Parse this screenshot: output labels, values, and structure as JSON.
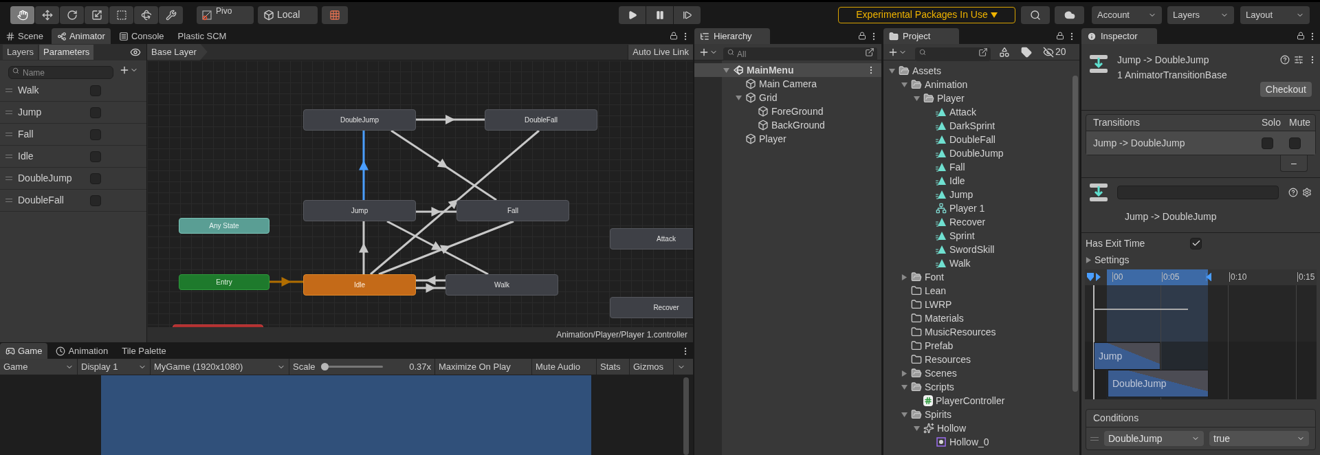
{
  "toolbar": {
    "tools": [
      {
        "kind": "hand",
        "selected": true
      },
      {
        "kind": "move",
        "selected": false
      },
      {
        "kind": "rotate",
        "selected": false
      },
      {
        "kind": "scale",
        "selected": false
      },
      {
        "kind": "rect",
        "selected": false
      },
      {
        "kind": "transform",
        "selected": false
      },
      {
        "kind": "custom",
        "selected": false
      }
    ],
    "pivot": "Pivo",
    "local": "Local",
    "experimental": "Experimental Packages In Use",
    "account": "Account",
    "layers": "Layers",
    "layout": "Layout"
  },
  "animator_panel": {
    "tabs": [
      {
        "label": "Scene",
        "kind": "scene",
        "selected": false
      },
      {
        "label": "Animator",
        "kind": "animator",
        "selected": true
      },
      {
        "label": "Console",
        "kind": "console",
        "selected": false
      },
      {
        "label": "Plastic SCM",
        "kind": "plain",
        "selected": false
      }
    ],
    "subtabs": [
      {
        "label": "Layers",
        "selected": false
      },
      {
        "label": "Parameters",
        "selected": true
      }
    ],
    "search_placeholder": "Name",
    "breadcrumb": "Base Layer",
    "live_link": "Auto Live Link",
    "parameters": [
      {
        "name": "Walk",
        "checked": false
      },
      {
        "name": "Jump",
        "checked": false
      },
      {
        "name": "Fall",
        "checked": false
      },
      {
        "name": "Idle",
        "checked": false
      },
      {
        "name": "DoubleJump",
        "checked": false
      },
      {
        "name": "DoubleFall",
        "checked": false
      }
    ],
    "states": [
      {
        "label": "DoubleJump",
        "kind": "state"
      },
      {
        "label": "DoubleFall",
        "kind": "state"
      },
      {
        "label": "Jump",
        "kind": "state"
      },
      {
        "label": "Fall",
        "kind": "state"
      },
      {
        "label": "Any State",
        "kind": "any"
      },
      {
        "label": "Entry",
        "kind": "entry"
      },
      {
        "label": "Idle",
        "kind": "default"
      },
      {
        "label": "Walk",
        "kind": "state"
      },
      {
        "label": "Attack",
        "kind": "state"
      },
      {
        "label": "Recover",
        "kind": "state"
      },
      {
        "kind": "exit"
      }
    ],
    "transitions": [
      {
        "kind": "normal",
        "selected": false
      },
      {
        "kind": "normal",
        "selected": false
      },
      {
        "kind": "normal",
        "selected": false
      },
      {
        "kind": "normal",
        "selected": false
      },
      {
        "kind": "normal",
        "selected": false
      },
      {
        "kind": "normal",
        "selected": false
      },
      {
        "kind": "normal",
        "selected": false
      },
      {
        "kind": "normal",
        "selected": false
      },
      {
        "kind": "normal",
        "selected": false
      },
      {
        "kind": "normal",
        "selected": true
      },
      {
        "kind": "entry",
        "selected": false
      }
    ],
    "path": "Animation/Player/Player 1.controller"
  },
  "game_panel": {
    "tabs": [
      {
        "label": "Game",
        "kind": "game",
        "selected": true
      },
      {
        "label": "Animation",
        "kind": "animation",
        "selected": false
      },
      {
        "label": "Tile Palette",
        "kind": "plain",
        "selected": false
      }
    ],
    "view_mode": "Game",
    "display": "Display 1",
    "resolution": "MyGame (1920x1080)",
    "scale_label": "Scale",
    "scale": {
      "level": 0.02
    },
    "scale_value": "0.37x",
    "maximize": "Maximize On Play",
    "mute": "Mute Audio",
    "stats": "Stats",
    "gizmos": "Gizmos"
  },
  "hierarchy": {
    "title": "Hierarchy",
    "search_placeholder": "All",
    "tree": [
      {
        "label": "MainMenu",
        "kind": "scene",
        "expanded": true,
        "children": [
          {
            "label": "Main Camera",
            "kind": "object"
          },
          {
            "label": "Grid",
            "kind": "object",
            "expanded": true,
            "children": [
              {
                "label": "ForeGround",
                "kind": "object"
              },
              {
                "label": "BackGround",
                "kind": "object"
              }
            ]
          },
          {
            "label": "Player",
            "kind": "object"
          }
        ]
      }
    ]
  },
  "project": {
    "title": "Project",
    "hidden_count": "20",
    "tree": [
      {
        "label": "Assets",
        "kind": "folder",
        "expanded": true,
        "children": [
          {
            "label": "Animation",
            "kind": "folder",
            "expanded": true,
            "children": [
              {
                "label": "Player",
                "kind": "folder",
                "expanded": true,
                "children": [
                  {
                    "label": "Attack",
                    "kind": "clip"
                  },
                  {
                    "label": "DarkSprint",
                    "kind": "clip"
                  },
                  {
                    "label": "DoubleFall",
                    "kind": "clip"
                  },
                  {
                    "label": "DoubleJump",
                    "kind": "clip"
                  },
                  {
                    "label": "Fall",
                    "kind": "clip"
                  },
                  {
                    "label": "Idle",
                    "kind": "clip"
                  },
                  {
                    "label": "Jump",
                    "kind": "clip"
                  },
                  {
                    "label": "Player 1",
                    "kind": "controller"
                  },
                  {
                    "label": "Recover",
                    "kind": "clip"
                  },
                  {
                    "label": "Sprint",
                    "kind": "clip"
                  },
                  {
                    "label": "SwordSkill",
                    "kind": "clip"
                  },
                  {
                    "label": "Walk",
                    "kind": "clip"
                  }
                ]
              }
            ]
          },
          {
            "label": "Font",
            "kind": "folder",
            "expanded": false
          },
          {
            "label": "Lean",
            "kind": "empty-folder"
          },
          {
            "label": "LWRP",
            "kind": "empty-folder"
          },
          {
            "label": "Materials",
            "kind": "empty-folder"
          },
          {
            "label": "MusicResources",
            "kind": "empty-folder"
          },
          {
            "label": "Prefab",
            "kind": "empty-folder"
          },
          {
            "label": "Resources",
            "kind": "empty-folder"
          },
          {
            "label": "Scenes",
            "kind": "folder",
            "expanded": false
          },
          {
            "label": "Scripts",
            "kind": "folder",
            "expanded": true,
            "children": [
              {
                "label": "PlayerController",
                "kind": "script"
              }
            ]
          },
          {
            "label": "Spirits",
            "kind": "folder",
            "expanded": true,
            "children": [
              {
                "label": "Hollow",
                "kind": "sheet",
                "expanded": true,
                "children": [
                  {
                    "label": "Hollow_0",
                    "kind": "sprite"
                  }
                ]
              }
            ]
          }
        ]
      }
    ]
  },
  "inspector": {
    "title": "Inspector",
    "heading": "Jump -> DoubleJump",
    "subheading": "1 AnimatorTransitionBase",
    "checkout": "Checkout",
    "transitions": {
      "header": "Transitions",
      "solo": "Solo",
      "mute": "Mute",
      "rows": [
        {
          "label": "Jump -> DoubleJump",
          "solo": false,
          "mute": false
        }
      ]
    },
    "remove": "–",
    "transition_name": "Jump -> DoubleJump",
    "has_exit_time": {
      "label": "Has Exit Time",
      "checked": true
    },
    "settings": {
      "label": "Settings",
      "expanded": false
    },
    "timeline": {
      "ticks": [
        "00",
        "0:05",
        "0:10",
        "0:15"
      ],
      "bars": [
        "Jump",
        "DoubleJump"
      ]
    },
    "conditions": {
      "header": "Conditions",
      "rows": [
        {
          "parameter": "DoubleJump",
          "value": "true"
        }
      ]
    }
  }
}
